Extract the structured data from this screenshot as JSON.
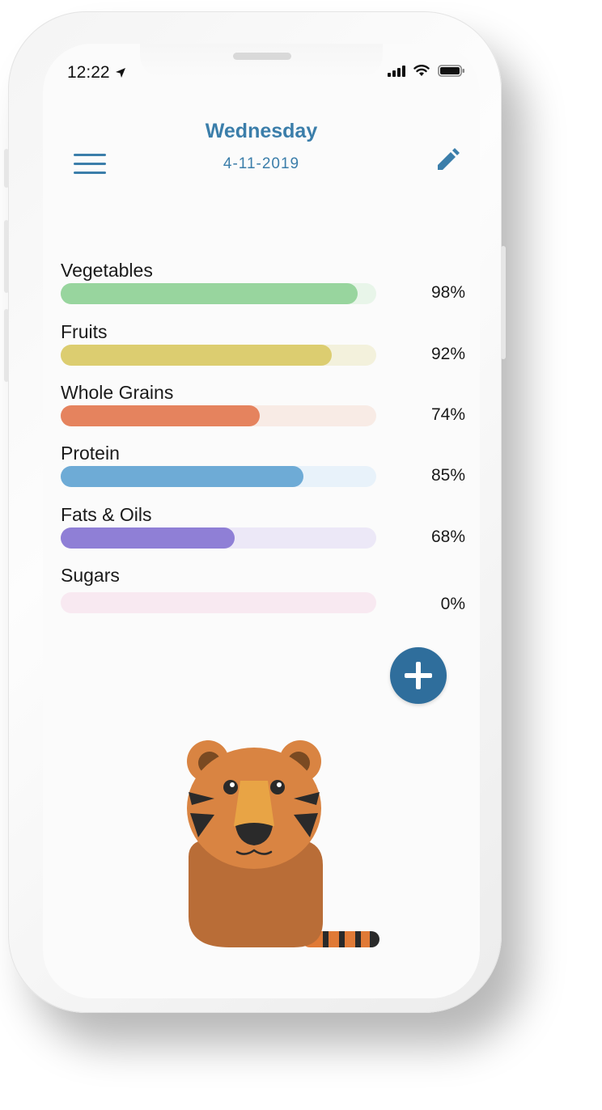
{
  "status_bar": {
    "time": "12:22"
  },
  "header": {
    "day": "Wednesday",
    "date": "4-11-2019"
  },
  "icons": {
    "menu": "hamburger-menu-icon",
    "edit": "pencil-icon",
    "add": "plus-icon",
    "location": "location-arrow-icon",
    "signal": "cellular-signal-icon",
    "wifi": "wifi-icon",
    "battery": "battery-icon"
  },
  "colors": {
    "accent": "#3b7eaa",
    "fab": "#2f6e9c"
  },
  "food_groups": [
    {
      "label": "Vegetables",
      "percent_text": "98%",
      "value": 0.94,
      "fill_color": "#98d59e",
      "track_color": "#e8f5e9"
    },
    {
      "label": "Fruits",
      "percent_text": "92%",
      "value": 0.86,
      "fill_color": "#dccd70",
      "track_color": "#f3f1dc"
    },
    {
      "label": "Whole Grains",
      "percent_text": "74%",
      "value": 0.63,
      "fill_color": "#e5835e",
      "track_color": "#f8ebe5"
    },
    {
      "label": "Protein",
      "percent_text": "85%",
      "value": 0.77,
      "fill_color": "#6eabd6",
      "track_color": "#e8f2fa"
    },
    {
      "label": "Fats & Oils",
      "percent_text": "68%",
      "value": 0.55,
      "fill_color": "#8f7fd6",
      "track_color": "#ece8f7"
    },
    {
      "label": "Sugars",
      "percent_text": "0%",
      "value": 0,
      "fill_color": "#f2c9dc",
      "track_color": "#f8e9f1"
    }
  ]
}
